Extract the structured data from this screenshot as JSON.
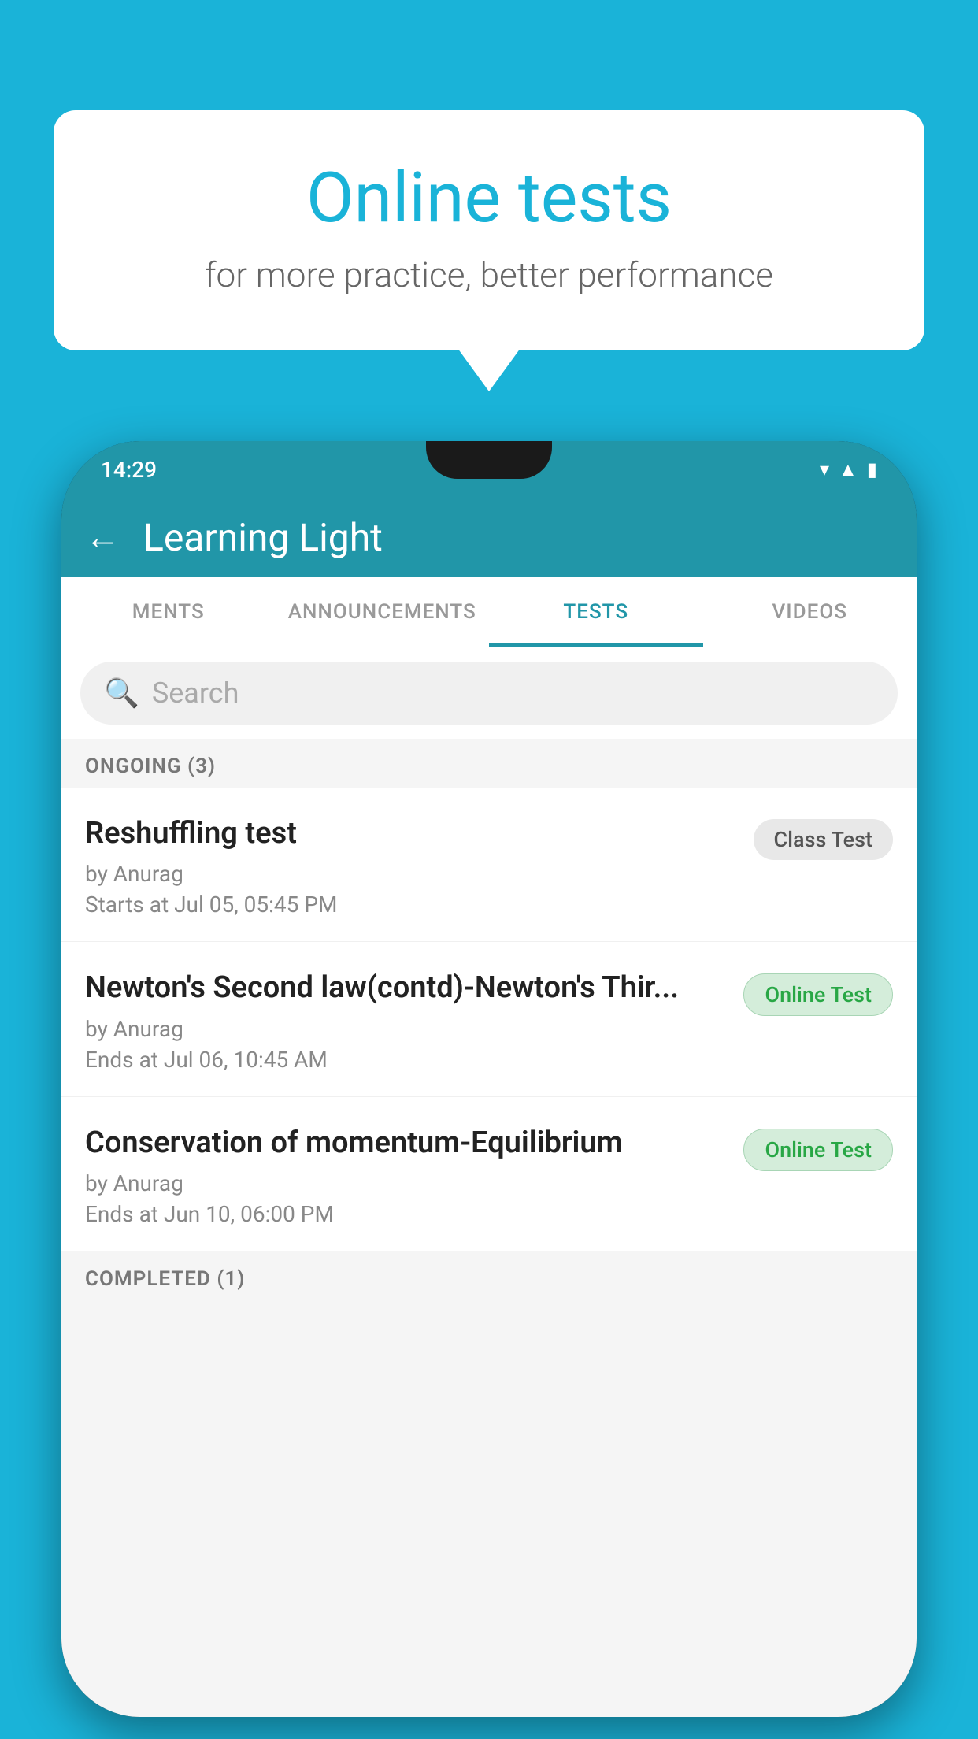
{
  "background": {
    "color": "#1ab3d8"
  },
  "speech_bubble": {
    "title": "Online tests",
    "subtitle": "for more practice, better performance"
  },
  "phone": {
    "status_bar": {
      "time": "14:29",
      "icons": [
        "wifi",
        "signal",
        "battery"
      ]
    },
    "app_bar": {
      "title": "Learning Light",
      "back_label": "←"
    },
    "tabs": [
      {
        "label": "MENTS",
        "active": false
      },
      {
        "label": "ANNOUNCEMENTS",
        "active": false
      },
      {
        "label": "TESTS",
        "active": true
      },
      {
        "label": "VIDEOS",
        "active": false
      }
    ],
    "search": {
      "placeholder": "Search"
    },
    "ongoing_section": {
      "label": "ONGOING (3)"
    },
    "tests": [
      {
        "name": "Reshuffling test",
        "author": "by Anurag",
        "date": "Starts at  Jul 05, 05:45 PM",
        "badge": "Class Test",
        "badge_type": "class"
      },
      {
        "name": "Newton's Second law(contd)-Newton's Thir...",
        "author": "by Anurag",
        "date": "Ends at  Jul 06, 10:45 AM",
        "badge": "Online Test",
        "badge_type": "online"
      },
      {
        "name": "Conservation of momentum-Equilibrium",
        "author": "by Anurag",
        "date": "Ends at  Jun 10, 06:00 PM",
        "badge": "Online Test",
        "badge_type": "online"
      }
    ],
    "completed_section": {
      "label": "COMPLETED (1)"
    }
  }
}
